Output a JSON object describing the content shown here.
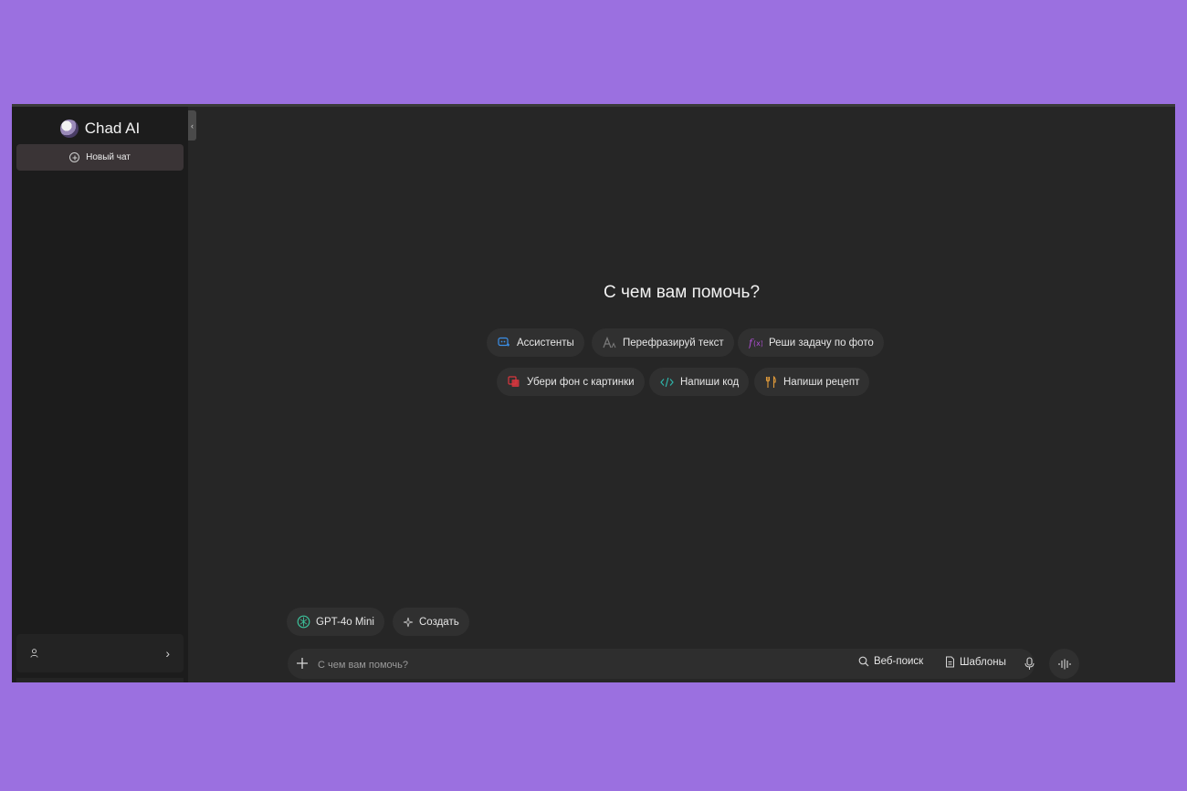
{
  "sidebar": {
    "brand_name": "Chad AI",
    "new_chat_label": "Новый чат",
    "collapse_glyph": "‹",
    "user_chevron": "›"
  },
  "main": {
    "heading": "С чем вам помочь?",
    "suggestions": [
      {
        "label": "Ассистенты",
        "icon": "assistant-icon",
        "color": "#3b8fe8"
      },
      {
        "label": "Перефразируй текст",
        "icon": "text-style-icon",
        "color": "#777777"
      },
      {
        "label": "Реши задачу по фото",
        "icon": "function-icon",
        "color": "#b04fd6"
      },
      {
        "label": "Убери фон с картинки",
        "icon": "remove-background-icon",
        "color": "#d9363e"
      },
      {
        "label": "Напиши код",
        "icon": "code-icon",
        "color": "#2fb3a8"
      },
      {
        "label": "Напиши рецепт",
        "icon": "cutlery-icon",
        "color": "#e09a3a"
      }
    ]
  },
  "composer": {
    "model_label": "GPT-4o Mini",
    "create_label": "Создать",
    "placeholder": "С чем вам помочь?",
    "web_search_label": "Веб-поиск",
    "templates_label": "Шаблоны"
  },
  "colors": {
    "page_background": "#9b70e0",
    "app_background": "#262626",
    "sidebar_background": "#1c1c1c",
    "new_chat_background": "#3a3436",
    "model_icon_color": "#3cc29b"
  }
}
